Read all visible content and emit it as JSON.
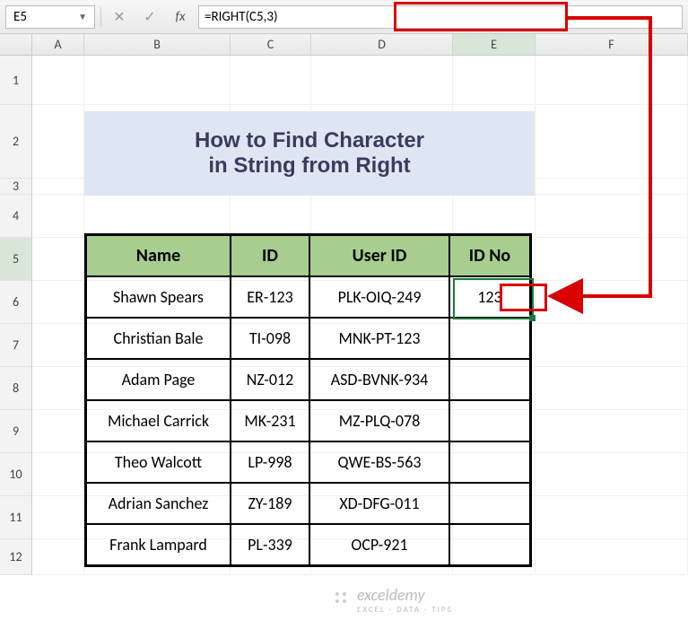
{
  "namebox": {
    "value": "E5"
  },
  "formula_bar": {
    "value": "=RIGHT(C5,3)"
  },
  "fx_label": "fx",
  "columns": [
    "A",
    "B",
    "C",
    "D",
    "E",
    "F"
  ],
  "rows": [
    "1",
    "2",
    "3",
    "4",
    "5",
    "6",
    "7",
    "8",
    "9",
    "10",
    "11",
    "12"
  ],
  "title": {
    "line1": "How to Find Character",
    "line2": "in String from Right"
  },
  "table": {
    "headers": {
      "name": "Name",
      "id": "ID",
      "userid": "User ID",
      "idno": "ID No"
    },
    "rows": [
      {
        "name": "Shawn Spears",
        "id": "ER-123",
        "userid": "PLK-OIQ-249",
        "idno": "123"
      },
      {
        "name": "Christian Bale",
        "id": "TI-098",
        "userid": "MNK-PT-123",
        "idno": ""
      },
      {
        "name": "Adam Page",
        "id": "NZ-012",
        "userid": "ASD-BVNK-934",
        "idno": ""
      },
      {
        "name": "Michael Carrick",
        "id": "MK-231",
        "userid": "MZ-PLQ-078",
        "idno": ""
      },
      {
        "name": "Theo Walcott",
        "id": "LP-998",
        "userid": "QWE-BS-563",
        "idno": ""
      },
      {
        "name": "Adrian Sanchez",
        "id": "ZY-189",
        "userid": "XD-DFG-011",
        "idno": ""
      },
      {
        "name": "Frank Lampard",
        "id": "PL-339",
        "userid": "OCP-921",
        "idno": ""
      }
    ]
  },
  "watermark": {
    "brand": "exceldemy",
    "sub": "EXCEL · DATA · TIPS"
  }
}
